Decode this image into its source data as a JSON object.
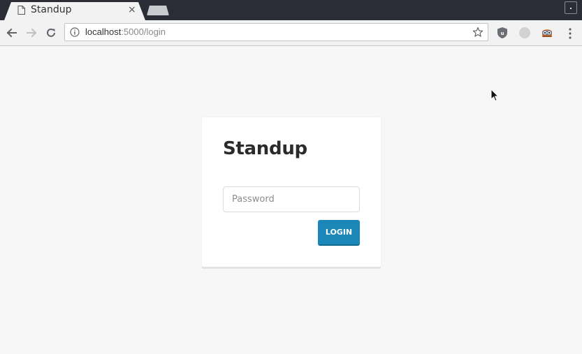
{
  "browser": {
    "tab": {
      "title": "Standup",
      "close_glyph": "×"
    },
    "window_button_glyph": ".",
    "address_bar": {
      "host": "localhost",
      "path": ":5000/login"
    },
    "icons": {
      "back": "arrow-left-icon",
      "forward": "arrow-right-icon",
      "reload": "reload-icon",
      "info": "info-icon",
      "bookmark": "star-icon",
      "extension_1": "ublock-icon",
      "extension_2": "circle-extension-icon",
      "extension_3": "owl-extension-icon",
      "menu": "kebab-menu-icon"
    }
  },
  "page": {
    "title": "Standup",
    "password": {
      "placeholder": "Password",
      "value": ""
    },
    "login_button": "LOGIN"
  },
  "colors": {
    "page_background": "#f7f7f7",
    "tabstrip": "#2a2d36",
    "accent_button": "#1a87b8"
  }
}
